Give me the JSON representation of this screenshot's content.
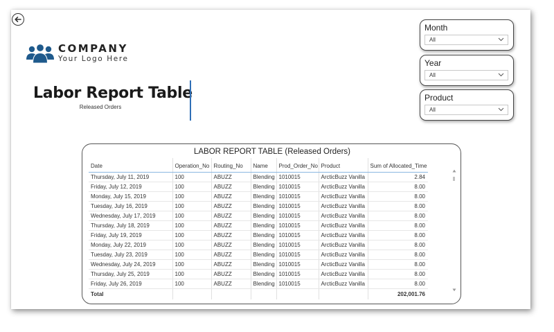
{
  "header": {
    "company_name": "COMPANY",
    "tagline": "Your Logo Here",
    "report_title": "Labor Report Table",
    "report_subtitle": "Released Orders"
  },
  "icons": {
    "back": "back-arrow-icon",
    "logo": "people-group-icon",
    "dropdown": "chevron-down-icon"
  },
  "colors": {
    "divider": "#2f6fb6",
    "header_rule": "#8ab6e0",
    "logo": "#1f5a8c"
  },
  "filters": {
    "month": {
      "label": "Month",
      "value": "All"
    },
    "year": {
      "label": "Year",
      "value": "All"
    },
    "product": {
      "label": "Product",
      "value": "All"
    }
  },
  "table": {
    "title": "LABOR REPORT TABLE (Released Orders)",
    "columns": [
      "Date",
      "Operation_No",
      "Routing_No",
      "Name",
      "Prod_Order_No",
      "Product",
      "Sum of Allocated_Time"
    ],
    "rows": [
      [
        "Thursday, July 11, 2019",
        "100",
        "ABUZZ",
        "Blending",
        "1010015",
        "ArcticBuzz Vanilla",
        "2.84"
      ],
      [
        "Friday, July 12, 2019",
        "100",
        "ABUZZ",
        "Blending",
        "1010015",
        "ArcticBuzz Vanilla",
        "8.00"
      ],
      [
        "Monday, July 15, 2019",
        "100",
        "ABUZZ",
        "Blending",
        "1010015",
        "ArcticBuzz Vanilla",
        "8.00"
      ],
      [
        "Tuesday, July 16, 2019",
        "100",
        "ABUZZ",
        "Blending",
        "1010015",
        "ArcticBuzz Vanilla",
        "8.00"
      ],
      [
        "Wednesday, July 17, 2019",
        "100",
        "ABUZZ",
        "Blending",
        "1010015",
        "ArcticBuzz Vanilla",
        "8.00"
      ],
      [
        "Thursday, July 18, 2019",
        "100",
        "ABUZZ",
        "Blending",
        "1010015",
        "ArcticBuzz Vanilla",
        "8.00"
      ],
      [
        "Friday, July 19, 2019",
        "100",
        "ABUZZ",
        "Blending",
        "1010015",
        "ArcticBuzz Vanilla",
        "8.00"
      ],
      [
        "Monday, July 22, 2019",
        "100",
        "ABUZZ",
        "Blending",
        "1010015",
        "ArcticBuzz Vanilla",
        "8.00"
      ],
      [
        "Tuesday, July 23, 2019",
        "100",
        "ABUZZ",
        "Blending",
        "1010015",
        "ArcticBuzz Vanilla",
        "8.00"
      ],
      [
        "Wednesday, July 24, 2019",
        "100",
        "ABUZZ",
        "Blending",
        "1010015",
        "ArcticBuzz Vanilla",
        "8.00"
      ],
      [
        "Thursday, July 25, 2019",
        "100",
        "ABUZZ",
        "Blending",
        "1010015",
        "ArcticBuzz Vanilla",
        "8.00"
      ],
      [
        "Friday, July 26, 2019",
        "100",
        "ABUZZ",
        "Blending",
        "1010015",
        "ArcticBuzz Vanilla",
        "8.00"
      ]
    ],
    "total": {
      "label": "Total",
      "value": "202,001.76"
    }
  }
}
